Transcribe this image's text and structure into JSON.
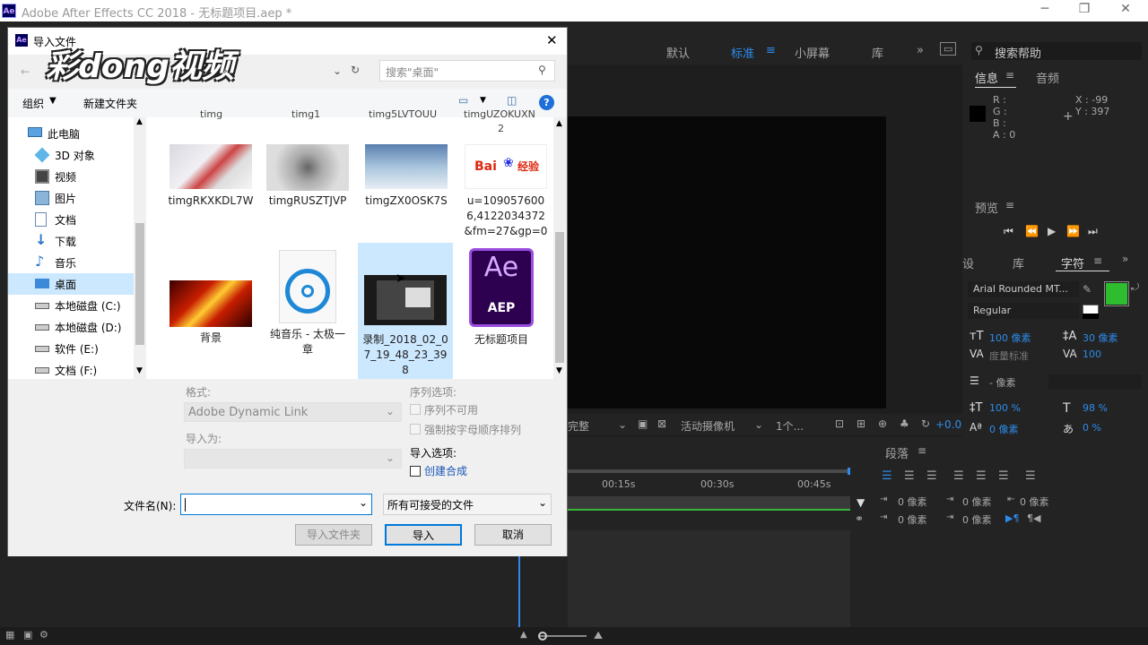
{
  "app": {
    "title": "Adobe After Effects CC 2018 - 无标题项目.aep *",
    "logo": "Ae"
  },
  "workspace": {
    "items": [
      "默认",
      "标准",
      "小屏幕",
      "库"
    ],
    "active": "标准",
    "search_placeholder": "搜索帮助"
  },
  "info_panel": {
    "tabs": [
      "信息",
      "音频"
    ],
    "r": "R :",
    "g": "G :",
    "b": "B :",
    "a": "A : 0",
    "x": "X : -99",
    "y": "Y : 397"
  },
  "preview_panel": {
    "title": "预览"
  },
  "character_panel": {
    "tabs": [
      "设",
      "库",
      "字符"
    ],
    "font": "Arial Rounded MT...",
    "style": "Regular",
    "size": "100 像素",
    "leading": "30 像素",
    "kerning": "度量标准",
    "tracking": "100",
    "stroke": "- 像素",
    "vscale": "100 %",
    "hscale": "98 %",
    "baseline": "0 像素",
    "tsume": "0 %",
    "fill_color": "#2ebd2e"
  },
  "paragraph_panel": {
    "title": "段落",
    "indent1": "0 像素",
    "indent2": "0 像素",
    "indent3": "0 像素",
    "space1": "0 像素",
    "space2": "0 像素"
  },
  "viewer_bar": {
    "quality": "完整",
    "camera": "活动摄像机",
    "views": "1个...",
    "exposure": "+0.0"
  },
  "timeline": {
    "ticks": [
      "00:15s",
      "00:30s",
      "00:45s"
    ]
  },
  "dialog": {
    "title": "导入文件",
    "watermark": "彩dong视频",
    "search_placeholder": "搜索\"桌面\"",
    "organize": "组织",
    "new_folder": "新建文件夹",
    "nav": [
      {
        "label": "此电脑",
        "icon": "computer-icon"
      },
      {
        "label": "3D 对象",
        "icon": "cube-icon"
      },
      {
        "label": "视频",
        "icon": "video-icon"
      },
      {
        "label": "图片",
        "icon": "pictures-icon"
      },
      {
        "label": "文档",
        "icon": "documents-icon"
      },
      {
        "label": "下载",
        "icon": "download-icon"
      },
      {
        "label": "音乐",
        "icon": "music-icon"
      },
      {
        "label": "桌面",
        "icon": "desktop-icon"
      },
      {
        "label": "本地磁盘 (C:)",
        "icon": "drive-icon"
      },
      {
        "label": "本地磁盘 (D:)",
        "icon": "drive-icon"
      },
      {
        "label": "软件 (E:)",
        "icon": "drive-icon"
      },
      {
        "label": "文档 (F:)",
        "icon": "drive-icon"
      }
    ],
    "top_row_partial": [
      "timg",
      "timg1",
      "timg5LVTOUU",
      "timgUZOKUXN",
      "2"
    ],
    "files": [
      {
        "name": "timgRKXKDL7W"
      },
      {
        "name": "timgRUSZTJVP"
      },
      {
        "name": "timgZX0OSK7S"
      },
      {
        "name": "u=1090576006,4122034372&fm=27&gp=0"
      },
      {
        "name": "背景"
      },
      {
        "name": "纯音乐 - 太极一章"
      },
      {
        "name": "录制_2018_02_07_19_48_23_398"
      },
      {
        "name": "无标题项目"
      }
    ],
    "baidu_logo": "Bai",
    "baidu_logo_cn": "经验",
    "ae_icon": "Ae",
    "ae_icon_sub": "AEP",
    "format_label": "格式:",
    "format_value": "Adobe Dynamic Link",
    "import_as_label": "导入为:",
    "sequence_label": "序列选项:",
    "seq_option1": "序列不可用",
    "seq_option2": "强制按字母顺序排列",
    "import_options_label": "导入选项:",
    "create_comp": "创建合成",
    "filename_label": "文件名(N):",
    "filename_value": "",
    "filter_value": "所有可接受的文件",
    "import_folder_btn": "导入文件夹",
    "import_btn": "导入",
    "cancel_btn": "取消"
  }
}
